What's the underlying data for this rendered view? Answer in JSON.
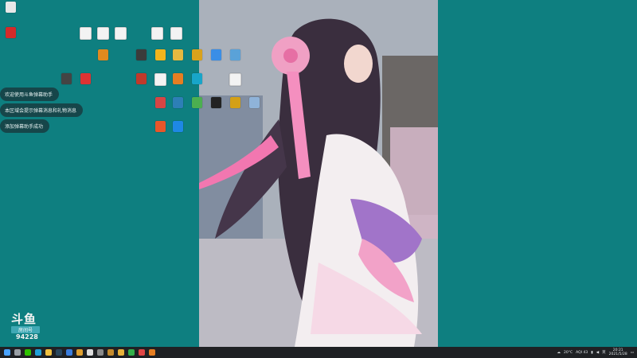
{
  "desktop": {
    "icons": [
      {
        "name": "recycle-bin",
        "label": "",
        "color": "#e8e8e8",
        "kind": "glyph"
      },
      {
        "name": "red-app",
        "label": "",
        "color": "#d42a2a",
        "kind": "glyph"
      },
      {
        "name": "doc-1",
        "label": "",
        "kind": "doc"
      },
      {
        "name": "doc-2",
        "label": "",
        "kind": "doc"
      },
      {
        "name": "doc-3",
        "label": "",
        "kind": "doc"
      },
      {
        "name": "doc-4",
        "label": "",
        "kind": "doc"
      },
      {
        "name": "doc-5",
        "label": "",
        "kind": "doc"
      },
      {
        "name": "app-orange",
        "label": "",
        "color": "#e08a1f",
        "kind": "glyph"
      },
      {
        "name": "app-game-a",
        "label": "",
        "color": "#3b3b3b",
        "kind": "glyph"
      },
      {
        "name": "app-yellow",
        "label": "",
        "color": "#f2b51c",
        "kind": "glyph"
      },
      {
        "name": "app-folder",
        "label": "",
        "color": "#e5b940",
        "kind": "glyph"
      },
      {
        "name": "app-bee",
        "label": "",
        "color": "#d9a21b",
        "kind": "glyph"
      },
      {
        "name": "app-blue-circle",
        "label": "",
        "color": "#3a8ee6",
        "kind": "glyph"
      },
      {
        "name": "app-monitor",
        "label": "",
        "color": "#5aa2d8",
        "kind": "glyph"
      },
      {
        "name": "app-dark-1",
        "label": "",
        "color": "#444",
        "kind": "glyph"
      },
      {
        "name": "app-red-dot",
        "label": "",
        "color": "#d33",
        "kind": "glyph"
      },
      {
        "name": "app-red-2",
        "label": "",
        "color": "#c0392b",
        "kind": "glyph"
      },
      {
        "name": "app-doc-gray",
        "label": "",
        "kind": "doc"
      },
      {
        "name": "app-orange-2",
        "label": "",
        "color": "#e67e22",
        "kind": "glyph"
      },
      {
        "name": "app-cyan",
        "label": "",
        "color": "#18a5c9",
        "kind": "glyph"
      },
      {
        "name": "doc-6",
        "label": "",
        "kind": "doc"
      },
      {
        "name": "app-multi",
        "label": "",
        "color": "#d64545",
        "kind": "glyph"
      },
      {
        "name": "app-gear",
        "label": "",
        "color": "#2d7fb6",
        "kind": "glyph"
      },
      {
        "name": "app-green",
        "label": "",
        "color": "#4caf50",
        "kind": "glyph"
      },
      {
        "name": "app-black-yellow",
        "label": "",
        "color": "#222",
        "kind": "glyph"
      },
      {
        "name": "app-bee-2",
        "label": "",
        "color": "#d4a017",
        "kind": "glyph"
      },
      {
        "name": "app-globe",
        "label": "",
        "color": "#8fb3d9",
        "kind": "glyph"
      },
      {
        "name": "app-flag",
        "label": "",
        "color": "#e8562a",
        "kind": "glyph"
      },
      {
        "name": "app-k",
        "label": "",
        "color": "#1e88e5",
        "kind": "glyph"
      }
    ]
  },
  "notifications": [
    "欢迎使用斗鱼弹幕助手",
    "本区域会提示弹幕消息和礼物消息",
    "添加弹幕助手成功"
  ],
  "overlay": {
    "brand": "斗鱼",
    "room_label": "房间号",
    "room_number": "94228"
  },
  "taskbar": {
    "apps": [
      {
        "name": "start",
        "color": "#4aa3ff"
      },
      {
        "name": "search",
        "color": "#9aa0a6"
      },
      {
        "name": "wechat",
        "color": "#2dc100"
      },
      {
        "name": "edge",
        "color": "#1fa0d8"
      },
      {
        "name": "folder",
        "color": "#f0c040"
      },
      {
        "name": "steam",
        "color": "#2a475e"
      },
      {
        "name": "app-blue",
        "color": "#3b7ddd"
      },
      {
        "name": "app-g",
        "color": "#e0a030"
      },
      {
        "name": "app-doc",
        "color": "#ddd"
      },
      {
        "name": "app-gray",
        "color": "#8a8a8a"
      },
      {
        "name": "app-gear",
        "color": "#c58b2d"
      },
      {
        "name": "app-yellow",
        "color": "#e8b23a"
      },
      {
        "name": "app-green",
        "color": "#33b04a"
      },
      {
        "name": "app-red",
        "color": "#e04646"
      },
      {
        "name": "app-orange",
        "color": "#e67e22"
      }
    ],
    "weather": "20°C",
    "aqi": "AQI 43",
    "input_method": "英",
    "time": "20:21",
    "date": "2021/5/28"
  }
}
